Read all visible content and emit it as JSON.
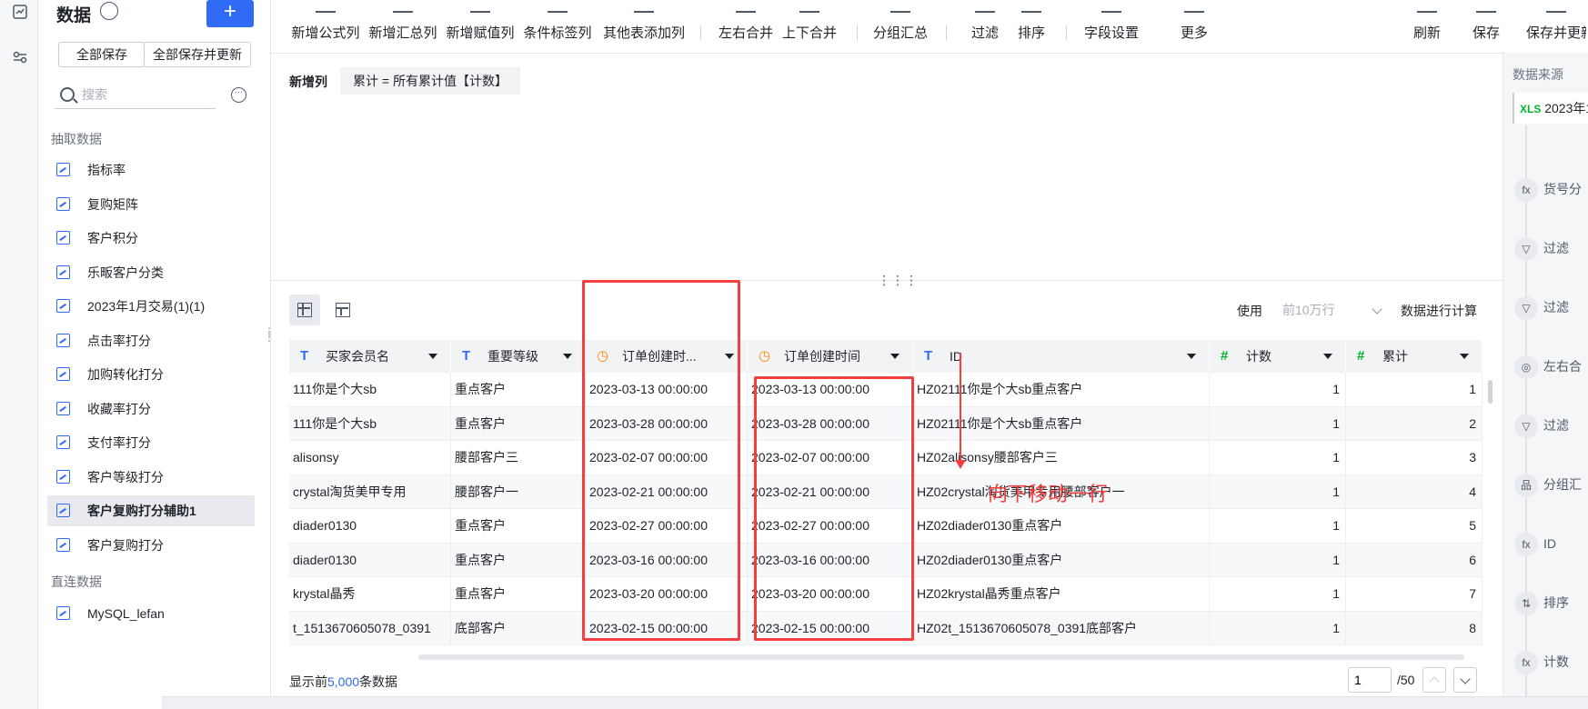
{
  "left_panel": {
    "title": "数据",
    "add_label": "+",
    "save_all": "全部保存",
    "save_all_update": "全部保存并更新",
    "search_placeholder": "搜索",
    "sections": {
      "extract": "抽取数据",
      "direct": "直连数据"
    },
    "extract_items": [
      "指标率",
      "复购矩阵",
      "客户积分",
      "乐畈客户分类",
      "2023年1月交易(1)(1)",
      "点击率打分",
      "加购转化打分",
      "收藏率打分",
      "支付率打分",
      "客户等级打分",
      "客户复购打分辅助1",
      "客户复购打分"
    ],
    "active_item": "客户复购打分辅助1",
    "direct_items": [
      "MySQL_lefan"
    ]
  },
  "toolbar": {
    "items": [
      "新增公式列",
      "新增汇总列",
      "新增赋值列",
      "条件标签列",
      "其他表添加列",
      "左右合并",
      "上下合并",
      "分组汇总",
      "过滤",
      "排序",
      "字段设置",
      "更多"
    ],
    "right_items": [
      "刷新",
      "保存",
      "保存并更新"
    ]
  },
  "formula": {
    "label": "新增列",
    "expression": "累计 = 所有累计值【计数】"
  },
  "table_controls": {
    "use_label": "使用",
    "rows_option": "前10万行",
    "calc_label": "数据进行计算"
  },
  "table": {
    "columns": [
      {
        "label": "买家会员名",
        "type": "text",
        "icon": "T"
      },
      {
        "label": "重要等级",
        "type": "text",
        "icon": "T"
      },
      {
        "label": "订单创建时...",
        "type": "time",
        "icon": "◷"
      },
      {
        "label": "订单创建时间",
        "type": "time",
        "icon": "◷"
      },
      {
        "label": "ID",
        "type": "text",
        "icon": "T"
      },
      {
        "label": "计数",
        "type": "num",
        "icon": "#"
      },
      {
        "label": "累计",
        "type": "num",
        "icon": "#"
      }
    ],
    "rows": [
      [
        "111你是个大sb",
        "重点客户",
        "2023-03-13 00:00:00",
        "2023-03-13 00:00:00",
        "HZ02111你是个大sb重点客户",
        "1",
        "1"
      ],
      [
        "111你是个大sb",
        "重点客户",
        "2023-03-28 00:00:00",
        "2023-03-28 00:00:00",
        "HZ02111你是个大sb重点客户",
        "1",
        "2"
      ],
      [
        "alisonsy",
        "腰部客户三",
        "2023-02-07 00:00:00",
        "2023-02-07 00:00:00",
        "HZ02alisonsy腰部客户三",
        "1",
        "3"
      ],
      [
        "crystal淘货美甲专用",
        "腰部客户一",
        "2023-02-21 00:00:00",
        "2023-02-21 00:00:00",
        "HZ02crystal淘货美甲专用腰部客户一",
        "1",
        "4"
      ],
      [
        "diader0130",
        "重点客户",
        "2023-02-27 00:00:00",
        "2023-02-27 00:00:00",
        "HZ02diader0130重点客户",
        "1",
        "5"
      ],
      [
        "diader0130",
        "重点客户",
        "2023-03-16 00:00:00",
        "2023-03-16 00:00:00",
        "HZ02diader0130重点客户",
        "1",
        "6"
      ],
      [
        "krystal晶秀",
        "重点客户",
        "2023-03-20 00:00:00",
        "2023-03-20 00:00:00",
        "HZ02krystal晶秀重点客户",
        "1",
        "7"
      ],
      [
        "t_1513670605078_0391",
        "底部客户",
        "2023-02-15 00:00:00",
        "2023-02-15 00:00:00",
        "HZ02t_1513670605078_0391底部客户",
        "1",
        "8"
      ]
    ]
  },
  "footer": {
    "prefix": "显示前",
    "count": "5,000",
    "suffix": "条数据",
    "page_value": "1",
    "page_total": "/50"
  },
  "right_panel": {
    "title": "数据来源",
    "source": "2023年1",
    "source_badge": "XLS",
    "steps": [
      {
        "icon": "fx",
        "label": "货号分"
      },
      {
        "icon": "▽",
        "label": "过滤"
      },
      {
        "icon": "▽",
        "label": "过滤"
      },
      {
        "icon": "◎",
        "label": "左右合"
      },
      {
        "icon": "▽",
        "label": "过滤"
      },
      {
        "icon": "品",
        "label": "分组汇"
      },
      {
        "icon": "fx",
        "label": "ID"
      },
      {
        "icon": "⇅",
        "label": "排序"
      },
      {
        "icon": "fx",
        "label": "计数"
      }
    ]
  },
  "annotation": {
    "note": "向下移动一行"
  },
  "colors": {
    "accent": "#2f6bf4",
    "annotation": "#f53f3f",
    "time_icon": "#ff8a00",
    "num_icon": "#00b42a"
  }
}
